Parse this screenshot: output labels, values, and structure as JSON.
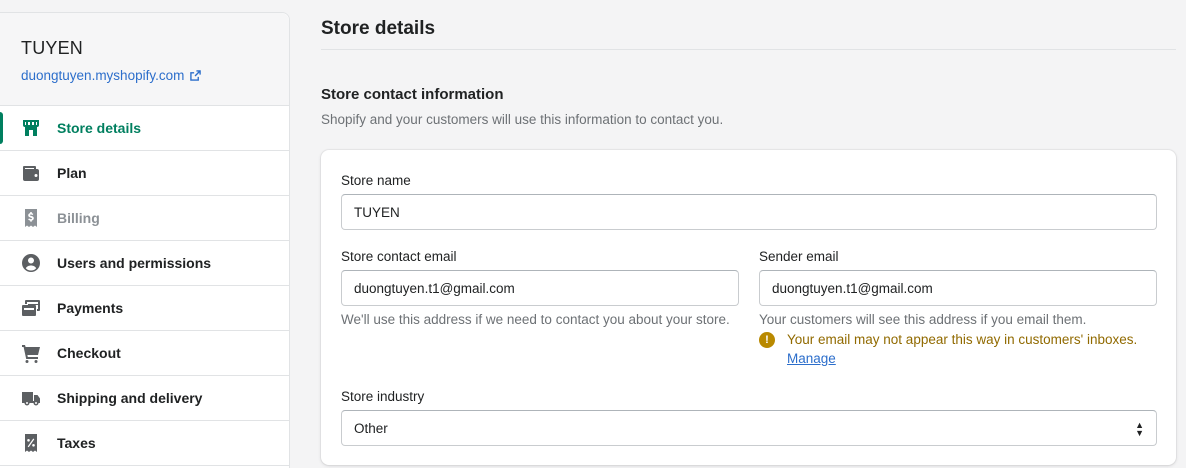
{
  "sidebar": {
    "store_name": "TUYEN",
    "store_url": "duongtuyen.myshopify.com",
    "items": [
      {
        "label": "Store details",
        "icon": "store-icon"
      },
      {
        "label": "Plan",
        "icon": "wallet-icon"
      },
      {
        "label": "Billing",
        "icon": "receipt-icon"
      },
      {
        "label": "Users and permissions",
        "icon": "user-circle-icon"
      },
      {
        "label": "Payments",
        "icon": "credit-card-icon"
      },
      {
        "label": "Checkout",
        "icon": "cart-icon"
      },
      {
        "label": "Shipping and delivery",
        "icon": "truck-icon"
      },
      {
        "label": "Taxes",
        "icon": "tax-receipt-icon"
      }
    ]
  },
  "main": {
    "page_title": "Store details",
    "section_title": "Store contact information",
    "section_description": "Shopify and your customers will use this information to contact you.",
    "store_name_label": "Store name",
    "store_name_value": "TUYEN",
    "contact_email_label": "Store contact email",
    "contact_email_value": "duongtuyen.t1@gmail.com",
    "contact_email_help": "We'll use this address if we need to contact you about your store.",
    "sender_email_label": "Sender email",
    "sender_email_value": "duongtuyen.t1@gmail.com",
    "sender_email_help": "Your customers will see this address if you email them.",
    "sender_email_warning": "Your email may not appear this way in customers' inboxes.",
    "manage_link": "Manage",
    "industry_label": "Store industry",
    "industry_value": "Other"
  },
  "colors": {
    "accent": "#007f5f",
    "link": "#2c6ecb",
    "warning": "#916a00"
  }
}
